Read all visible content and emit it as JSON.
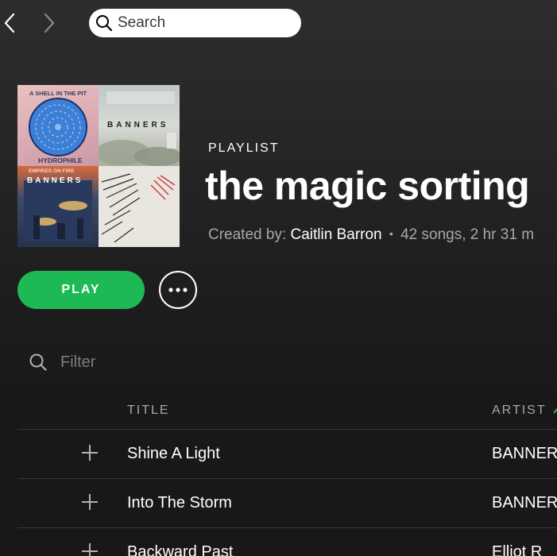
{
  "nav": {
    "back_icon": "chevron-left-icon",
    "forward_icon": "chevron-right-icon"
  },
  "search": {
    "placeholder": "Search",
    "value": ""
  },
  "cover": {
    "tiles": [
      {
        "top_text": "A SHELL IN THE PIT",
        "bottom_text": "HYDROPHILE"
      },
      {
        "text": "BANNERS"
      },
      {
        "top_text": "EMPIRES ON FIRE",
        "text": "BANNERS"
      },
      {
        "text": ""
      }
    ]
  },
  "playlist": {
    "kind": "PLAYLIST",
    "title": "the magic sorting",
    "created_by_label": "Created by:",
    "owner": "Caitlin Barron",
    "separator": "•",
    "stats": "42 songs, 2 hr 31 m"
  },
  "actions": {
    "play_label": "PLAY",
    "more_icon": "more-horizontal-icon"
  },
  "filter": {
    "placeholder": "Filter",
    "value": ""
  },
  "table": {
    "columns": {
      "title": "TITLE",
      "artist": "ARTIST",
      "artist_sort": "ascending"
    },
    "rows": [
      {
        "title": "Shine A Light",
        "artist": "BANNER"
      },
      {
        "title": "Into The Storm",
        "artist": "BANNER"
      },
      {
        "title": "Backward Past",
        "artist": "Elliot R"
      }
    ]
  },
  "colors": {
    "accent": "#1db954",
    "background": "#181818",
    "muted_text": "#a8a8a8"
  }
}
